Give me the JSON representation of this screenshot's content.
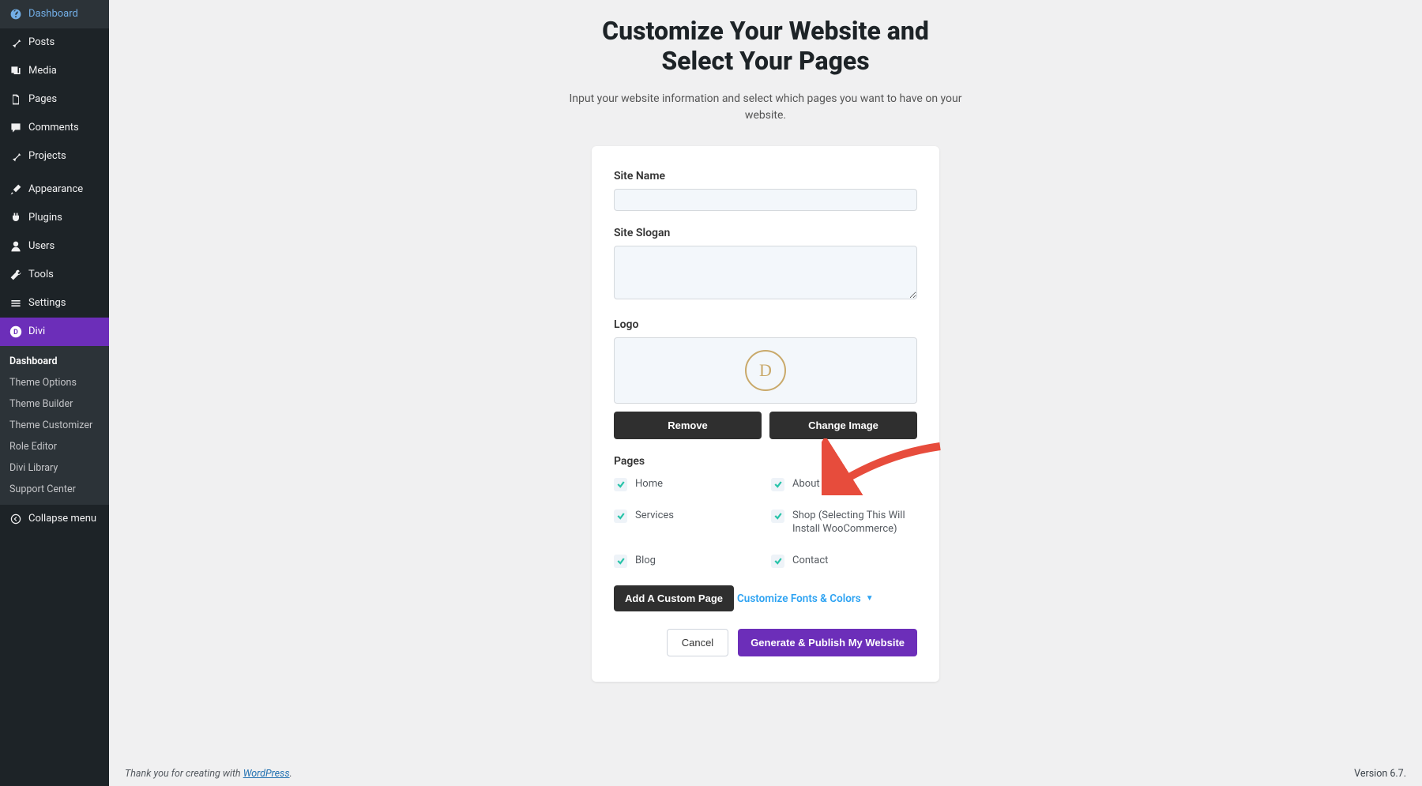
{
  "sidebar": {
    "items": [
      {
        "label": "Dashboard"
      },
      {
        "label": "Posts"
      },
      {
        "label": "Media"
      },
      {
        "label": "Pages"
      },
      {
        "label": "Comments"
      },
      {
        "label": "Projects"
      },
      {
        "label": "Appearance"
      },
      {
        "label": "Plugins"
      },
      {
        "label": "Users"
      },
      {
        "label": "Tools"
      },
      {
        "label": "Settings"
      },
      {
        "label": "Divi"
      }
    ],
    "submenu": [
      "Dashboard",
      "Theme Options",
      "Theme Builder",
      "Theme Customizer",
      "Role Editor",
      "Divi Library",
      "Support Center"
    ],
    "collapse": "Collapse menu"
  },
  "header": {
    "title1": "Customize Your Website and",
    "title2": "Select Your Pages",
    "subtitle": "Input your website information and select which pages you want to have on your website."
  },
  "form": {
    "site_name_label": "Site Name",
    "site_name_value": "",
    "site_slogan_label": "Site Slogan",
    "site_slogan_value": "",
    "logo_label": "Logo",
    "logo_letter": "D",
    "remove_btn": "Remove",
    "change_btn": "Change Image",
    "pages_label": "Pages",
    "pages": [
      {
        "label": "Home",
        "checked": true
      },
      {
        "label": "About",
        "checked": true
      },
      {
        "label": "Services",
        "checked": true
      },
      {
        "label": "Shop (Selecting This Will Install WooCommerce)",
        "checked": true
      },
      {
        "label": "Blog",
        "checked": true
      },
      {
        "label": "Contact",
        "checked": true
      }
    ],
    "add_custom_page": "Add A Custom Page",
    "customize_link": "Customize Fonts & Colors",
    "cancel_btn": "Cancel",
    "generate_btn": "Generate & Publish My Website"
  },
  "footer": {
    "thank_prefix": "Thank you for creating with ",
    "link": "WordPress",
    "thank_suffix": ".",
    "version": "Version 6.7."
  },
  "colors": {
    "accent": "#6c2eb9",
    "check": "#29c4a9",
    "link": "#2ea3f2",
    "arrow": "#e74c3c"
  }
}
